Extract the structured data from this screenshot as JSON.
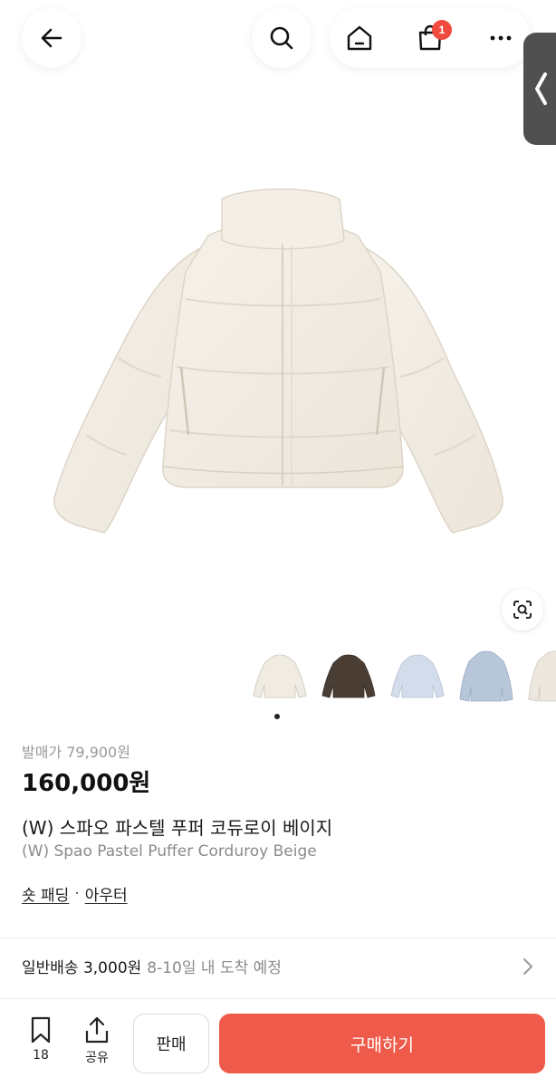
{
  "header": {
    "cart_count": "1",
    "icons": [
      "back-arrow-icon",
      "search-icon",
      "home-icon",
      "shopping-bag-icon",
      "more-icon"
    ]
  },
  "product": {
    "original_price": "발매가 79,900원",
    "price": "160,000원",
    "title_ko": "(W) 스파오 파스텔 푸퍼 코듀로이 베이지",
    "title_en": "(W) Spao Pastel Puffer Corduroy Beige",
    "category_primary": "숏 패딩",
    "category_separator": "·",
    "category_secondary": "아우터",
    "thumbnail_colors": [
      "#f0ece3",
      "#4a3d33",
      "#d2dcea",
      "#b7c6d9",
      "#ece8df"
    ]
  },
  "shipping": {
    "label": "일반배송 3,000원",
    "eta": "8-10일 내 도착 예정"
  },
  "bottom_bar": {
    "bookmark_count": "18",
    "share_label": "공유",
    "sell_label": "판매",
    "buy_label": "구매하기"
  },
  "colors": {
    "accent": "#ef5b4a",
    "badge": "#ef4b3f"
  }
}
